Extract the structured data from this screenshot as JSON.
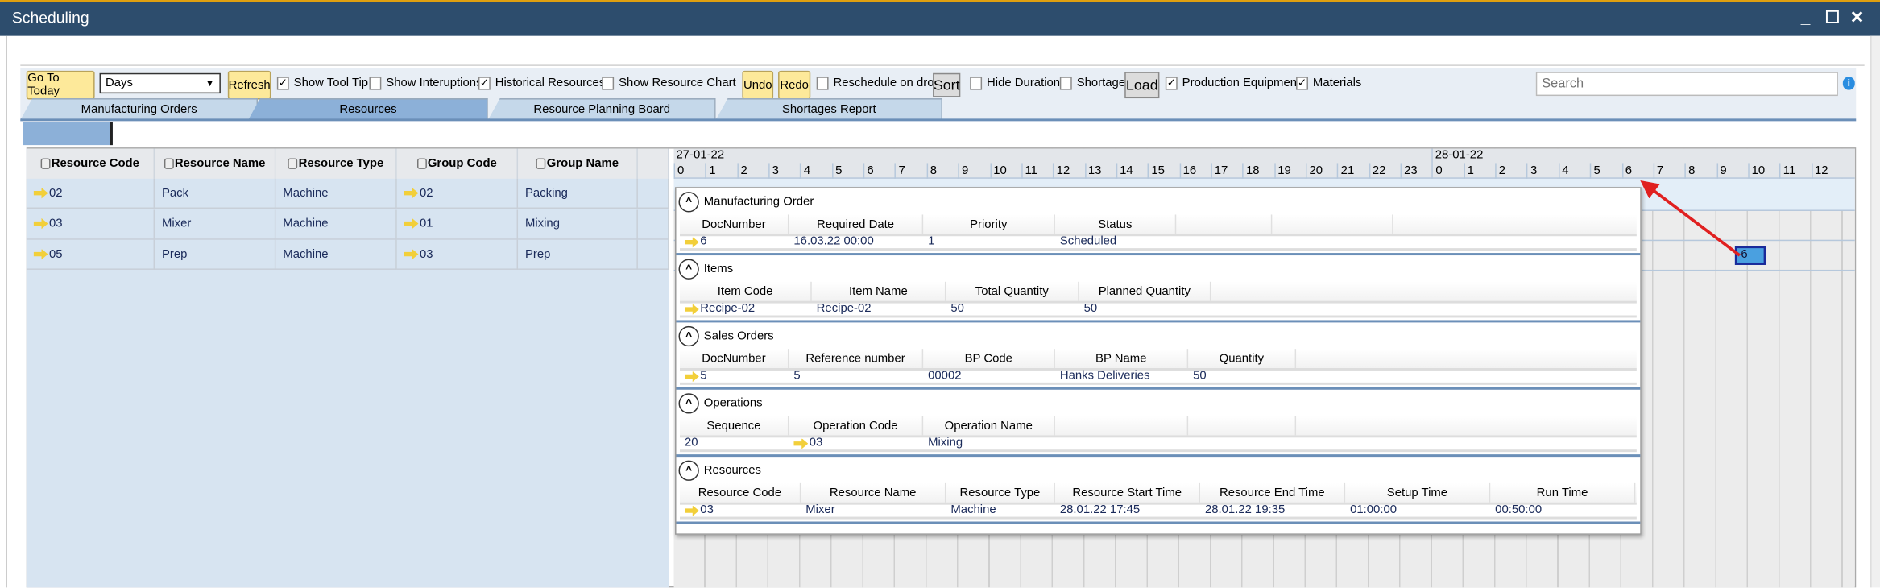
{
  "window": {
    "title": "Scheduling",
    "minimize": "_",
    "maximize": "☐",
    "close": "✕"
  },
  "toolbar": {
    "go_to_today": "Go To Today",
    "view_select": "Days",
    "refresh": "Refresh",
    "show_tool_tip": {
      "label": "Show Tool Tip",
      "checked": true
    },
    "show_interuptions": {
      "label": "Show Interuptions",
      "checked": false
    },
    "historical_resources": {
      "label": "Historical Resources",
      "checked": true
    },
    "show_resource_chart": {
      "label": "Show Resource Chart",
      "checked": false
    },
    "undo": "Undo",
    "redo": "Redo",
    "reschedule_on_drop": {
      "label": "Reschedule on drop",
      "checked": false
    },
    "sort": "Sort",
    "hide_duration": {
      "label": "Hide Duration",
      "checked": false
    },
    "shortages": {
      "label": "Shortages",
      "checked": false
    },
    "load": "Load",
    "production_equipment": {
      "label": "Production Equipment",
      "checked": true
    },
    "materials": {
      "label": "Materials",
      "checked": true
    },
    "search_placeholder": "Search",
    "info_icon": "info-icon"
  },
  "tabs": [
    {
      "label": "Manufacturing Orders",
      "active": false
    },
    {
      "label": "Resources",
      "active": true
    },
    {
      "label": "Resource Planning Board",
      "active": false
    },
    {
      "label": "Shortages Report",
      "active": false
    }
  ],
  "resources_table": {
    "columns": [
      "Resource Code",
      "Resource Name",
      "Resource Type",
      "Group Code",
      "Group Name"
    ],
    "rows": [
      [
        "02",
        "Pack",
        "Machine",
        "02",
        "Packing"
      ],
      [
        "03",
        "Mixer",
        "Machine",
        "01",
        "Mixing"
      ],
      [
        "05",
        "Prep",
        "Machine",
        "03",
        "Prep"
      ]
    ]
  },
  "gantt": {
    "dates": [
      "27-01-22",
      "28-01-22"
    ],
    "hours": [
      "0",
      "1",
      "2",
      "3",
      "4",
      "5",
      "6",
      "7",
      "8",
      "9",
      "10",
      "11",
      "12",
      "13",
      "14",
      "15",
      "16",
      "17",
      "18",
      "19",
      "20",
      "21",
      "22",
      "23",
      "0",
      "1",
      "2",
      "3",
      "4",
      "5",
      "6",
      "7",
      "8",
      "9",
      "10",
      "11",
      "12"
    ],
    "task_label": "6",
    "accent": "#4aa0e0"
  },
  "tooltip": {
    "sections": [
      {
        "title": "Manufacturing Order",
        "columns": [
          "DocNumber",
          "Required Date",
          "Priority",
          "Status",
          "",
          ""
        ],
        "rows": [
          [
            "6",
            "16.03.22 00:00",
            "1",
            "Scheduled",
            "",
            ""
          ]
        ],
        "links": [
          0
        ]
      },
      {
        "title": "Items",
        "columns": [
          "Item Code",
          "Item Name",
          "Total Quantity",
          "Planned Quantity"
        ],
        "rows": [
          [
            "Recipe-02",
            "Recipe-02",
            "50",
            "50"
          ]
        ],
        "links": [
          0
        ]
      },
      {
        "title": "Sales Orders",
        "columns": [
          "DocNumber",
          "Reference number",
          "BP Code",
          "BP Name",
          "Quantity"
        ],
        "rows": [
          [
            "5",
            "5",
            "00002",
            "Hanks Deliveries",
            "50"
          ]
        ],
        "links": [
          0
        ]
      },
      {
        "title": "Operations",
        "columns": [
          "Sequence",
          "Operation Code",
          "Operation Name",
          "",
          ""
        ],
        "rows": [
          [
            "20",
            "03",
            "Mixing",
            "",
            ""
          ]
        ],
        "links": [
          1
        ]
      },
      {
        "title": "Resources",
        "columns": [
          "Resource Code",
          "Resource Name",
          "Resource Type",
          "Resource Start Time",
          "Resource End Time",
          "Setup Time",
          "Run Time"
        ],
        "rows": [
          [
            "03",
            "Mixer",
            "Machine",
            "28.01.22 17:45",
            "28.01.22 19:35",
            "01:00:00",
            "00:50:00"
          ]
        ],
        "links": [
          0
        ]
      }
    ]
  }
}
